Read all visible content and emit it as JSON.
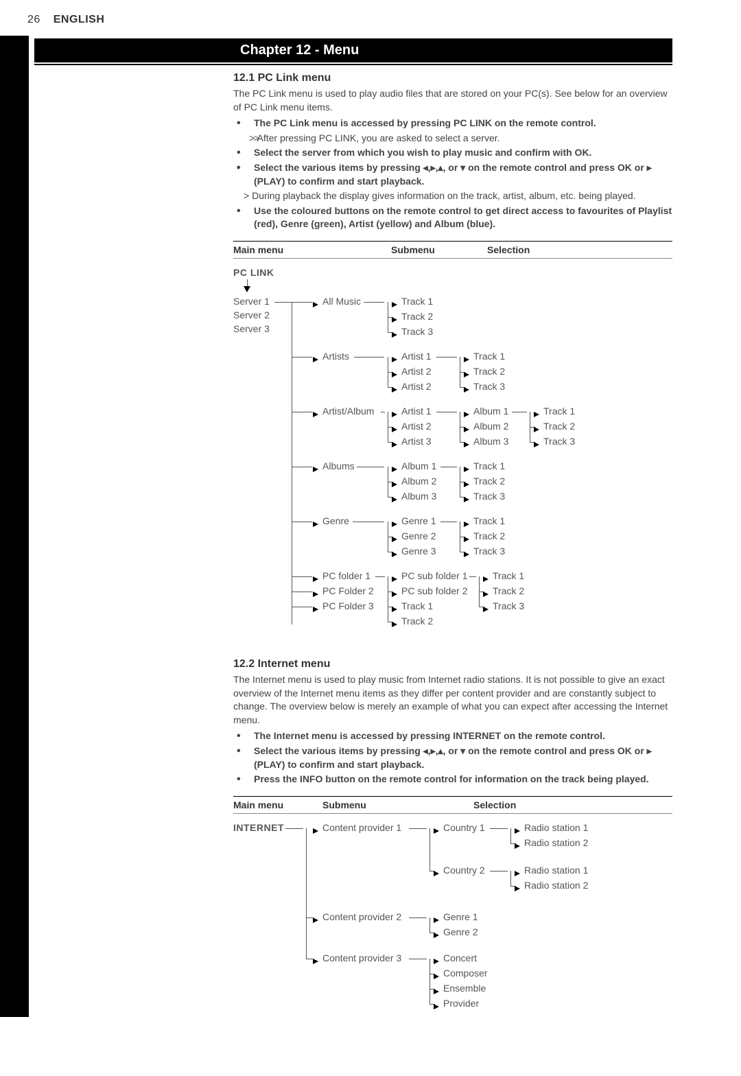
{
  "header": {
    "pageNumber": "26",
    "language": "ENGLISH"
  },
  "chapterTitle": "Chapter 12 - Menu",
  "section1": {
    "heading": "12.1 PC Link menu",
    "intro": "The PC Link menu is used to play audio files that are stored on your PC(s). See below for an overview of PC Link menu items.",
    "b1": "The PC Link menu is accessed by pressing PC LINK on the remote control.",
    "b1sub": "After pressing PC LINK, you are asked to select a server.",
    "b2": "Select the server from which you wish to play music and confirm with OK.",
    "b3pre": "Select the various items by pressing ",
    "b3post": " on the remote control and press OK or ▸ (PLAY) to confirm and start playback.",
    "b3sub": "During playback the display gives information on the track, artist, album, etc. being played.",
    "b4": "Use the coloured buttons on the remote control to get direct access to favourites of Playlist (red), Genre (green), Artist (yellow) and Album (blue).",
    "tableHdr": {
      "c1": "Main menu",
      "c2": "Submenu",
      "c3": "Selection"
    },
    "root": "PC LINK",
    "servers": [
      "Server 1",
      "Server 2",
      "Server 3"
    ],
    "allMusic": "All Music",
    "tracks": [
      "Track 1",
      "Track 2",
      "Track 3"
    ],
    "artists": "Artists",
    "artistList": [
      "Artist 1",
      "Artist 2",
      "Artist 2"
    ],
    "artistAlbum": "Artist/Album",
    "artistAlbumArtists": [
      "Artist 1",
      "Artist 2",
      "Artist 3"
    ],
    "artistAlbumAlbums": [
      "Album 1",
      "Album 2",
      "Album 3"
    ],
    "albums": "Albums",
    "albumList": [
      "Album 1",
      "Album 2",
      "Album 3"
    ],
    "genre": "Genre",
    "genreList": [
      "Genre 1",
      "Genre 2",
      "Genre 3"
    ],
    "pcFolders": [
      "PC folder 1",
      "PC Folder 2",
      "PC Folder 3"
    ],
    "pcSubFolders": [
      "PC sub folder 1",
      "PC sub folder 2",
      "Track 1",
      "Track 2"
    ]
  },
  "section2": {
    "heading": "12.2 Internet menu",
    "intro": "The Internet menu is used to play music from Internet radio stations. It is not possible to give an exact overview of the Internet menu items as they differ per content provider and are constantly subject to change. The overview below is merely an example of what you can expect after accessing the Internet menu.",
    "b1": "The Internet menu is accessed by pressing INTERNET on the remote control.",
    "b2pre": "Select the various items by pressing ",
    "b2post": " on the remote control and press OK or ▸ (PLAY) to confirm and start playback.",
    "b3": "Press the INFO button on the remote control for information on the track being played.",
    "tableHdr": {
      "c1": "Main menu",
      "c2": "Submenu",
      "c3": "Selection"
    },
    "root": "INTERNET",
    "providers": [
      "Content provider 1",
      "Content provider 2",
      "Content provider 3"
    ],
    "countries": [
      "Country 1",
      "Country 2"
    ],
    "stations": [
      "Radio station 1",
      "Radio station 2"
    ],
    "p2sub": [
      "Genre 1",
      "Genre 2"
    ],
    "p3sub": [
      "Concert",
      "Composer",
      "Ensemble",
      "Provider"
    ]
  }
}
